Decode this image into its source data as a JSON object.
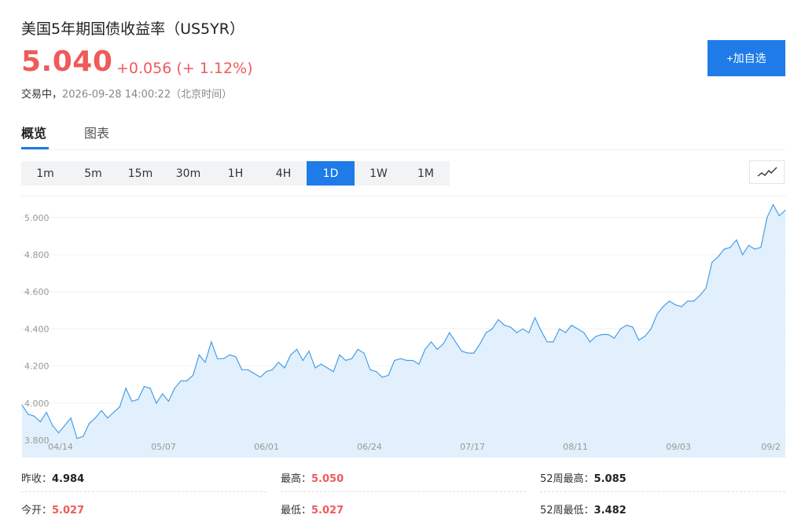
{
  "header": {
    "title": "美国5年期国债收益率（US5YR）",
    "price": "5.040",
    "change": "+0.056 (+ 1.12%)",
    "status_label": "交易中，",
    "timestamp": "2026-09-28 14:00:22（北京时间）",
    "add_button": "+加自选"
  },
  "tabs": [
    {
      "label": "概览",
      "active": true
    },
    {
      "label": "图表",
      "active": false
    }
  ],
  "ranges": [
    {
      "label": "1m",
      "active": false
    },
    {
      "label": "5m",
      "active": false
    },
    {
      "label": "15m",
      "active": false
    },
    {
      "label": "30m",
      "active": false
    },
    {
      "label": "1H",
      "active": false
    },
    {
      "label": "4H",
      "active": false
    },
    {
      "label": "1D",
      "active": true
    },
    {
      "label": "1W",
      "active": false
    },
    {
      "label": "1M",
      "active": false
    }
  ],
  "chart_toggle_icon": "line-chart-icon",
  "colors": {
    "up": "#f05a5a",
    "accent": "#1e7be8",
    "line": "#4a9ee8",
    "fill": "#deeefc"
  },
  "chart_data": {
    "type": "area",
    "x_tick_labels": [
      "04/14",
      "05/07",
      "06/01",
      "06/24",
      "07/17",
      "08/11",
      "09/03",
      "09/2"
    ],
    "y_tick_labels": [
      "3.800",
      "4.000",
      "4.200",
      "4.400",
      "4.600",
      "4.800",
      "5.000"
    ],
    "ylim": [
      3.8,
      5.1
    ],
    "grid": true,
    "series": [
      {
        "values": [
          3.99,
          3.94,
          3.93,
          3.9,
          3.95,
          3.88,
          3.84,
          3.88,
          3.92,
          3.81,
          3.82,
          3.89,
          3.92,
          3.96,
          3.92,
          3.95,
          3.98,
          4.08,
          4.01,
          4.02,
          4.09,
          4.08,
          4.0,
          4.05,
          4.01,
          4.08,
          4.12,
          4.12,
          4.15,
          4.26,
          4.22,
          4.33,
          4.24,
          4.24,
          4.26,
          4.25,
          4.18,
          4.18,
          4.16,
          4.14,
          4.17,
          4.18,
          4.22,
          4.19,
          4.26,
          4.29,
          4.23,
          4.28,
          4.19,
          4.21,
          4.19,
          4.17,
          4.26,
          4.23,
          4.24,
          4.29,
          4.27,
          4.18,
          4.17,
          4.14,
          4.15,
          4.23,
          4.24,
          4.23,
          4.23,
          4.21,
          4.29,
          4.33,
          4.29,
          4.32,
          4.38,
          4.33,
          4.28,
          4.27,
          4.27,
          4.32,
          4.38,
          4.4,
          4.45,
          4.42,
          4.41,
          4.38,
          4.4,
          4.38,
          4.46,
          4.39,
          4.33,
          4.33,
          4.4,
          4.38,
          4.42,
          4.4,
          4.38,
          4.33,
          4.36,
          4.37,
          4.37,
          4.35,
          4.4,
          4.42,
          4.41,
          4.34,
          4.36,
          4.4,
          4.48,
          4.52,
          4.55,
          4.53,
          4.52,
          4.55,
          4.55,
          4.58,
          4.62,
          4.76,
          4.79,
          4.83,
          4.84,
          4.88,
          4.8,
          4.85,
          4.83,
          4.84,
          5.0,
          5.07,
          5.01,
          5.04
        ]
      }
    ]
  },
  "stats": {
    "row1": [
      {
        "label": "昨收：",
        "value": "4.984"
      },
      {
        "label": "最高：",
        "value": "5.050"
      },
      {
        "label": "52周最高：",
        "value": "5.085"
      }
    ],
    "row2": [
      {
        "label": "今开：",
        "value": "5.027"
      },
      {
        "label": "最低：",
        "value": "5.027"
      },
      {
        "label": "52周最低：",
        "value": "3.482"
      }
    ]
  }
}
